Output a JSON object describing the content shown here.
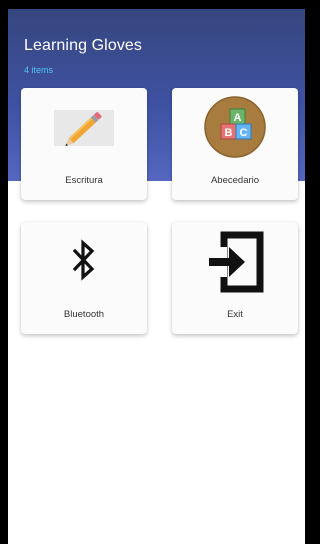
{
  "header": {
    "title": "Learning Gloves",
    "subtitle": "4 items"
  },
  "cards": [
    {
      "label": "Escritura",
      "icon": "pencil-icon"
    },
    {
      "label": "Abecedario",
      "icon": "abc-blocks-icon"
    },
    {
      "label": "Bluetooth",
      "icon": "bluetooth-icon"
    },
    {
      "label": "Exit",
      "icon": "exit-icon"
    }
  ],
  "blocks": {
    "a": "A",
    "b": "B",
    "c": "C"
  },
  "colors": {
    "header_top": "#36467e",
    "header_bottom": "#5567bf",
    "subtitle": "#4fc3f7",
    "card_bg": "#fbfbfb"
  }
}
